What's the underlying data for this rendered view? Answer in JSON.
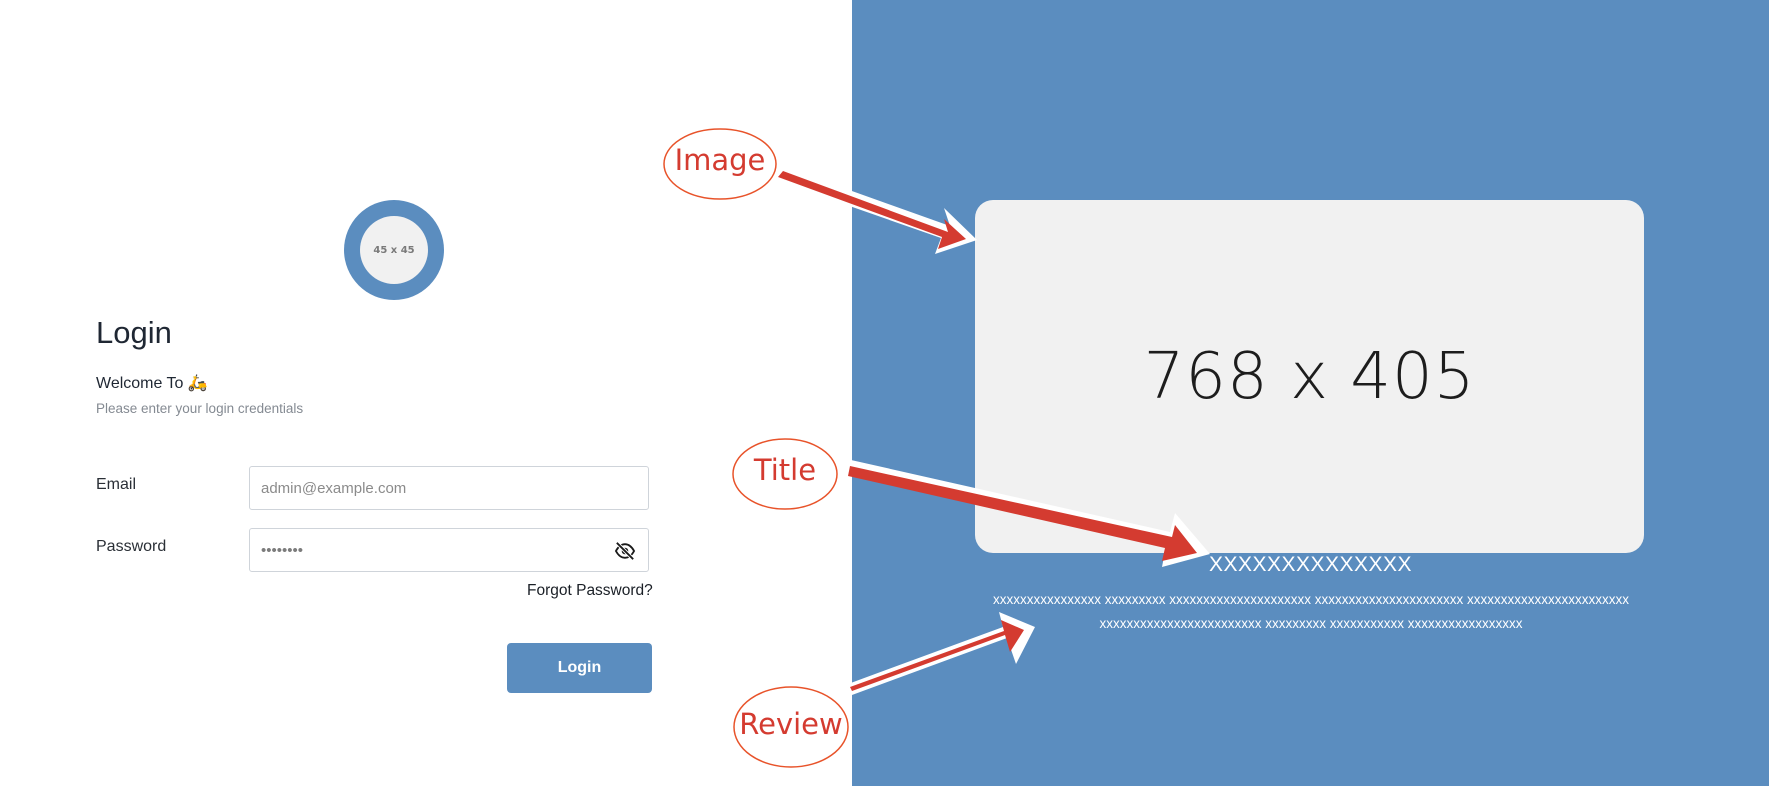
{
  "logo": {
    "text": "45 x 45"
  },
  "login": {
    "title": "Login",
    "welcome": "Welcome To 🛵",
    "subtitle": "Please enter your login credentials",
    "email_label": "Email",
    "email_placeholder": "admin@example.com",
    "password_label": "Password",
    "password_value": "********",
    "forgot_label": "Forgot Password?",
    "submit_label": "Login"
  },
  "slide": {
    "image_text": "768 x 405",
    "title": "XXXXXXXXXXXXXX",
    "review": "xxxxxxxxxxxxxxxx xxxxxxxxx xxxxxxxxxxxxxxxxxxxxx xxxxxxxxxxxxxxxxxxxxxx xxxxxxxxxxxxxxxxxxxxxxxx xxxxxxxxxxxxxxxxxxxxxxxx xxxxxxxxx xxxxxxxxxxx xxxxxxxxxxxxxxxxx"
  },
  "annotations": {
    "image_label": "Image",
    "title_label": "Title",
    "review_label": "Review",
    "color": "#d43b30"
  },
  "colors": {
    "accent": "#5b8dbf",
    "card": "#f1f1f1",
    "annotation": "#d43b30"
  }
}
